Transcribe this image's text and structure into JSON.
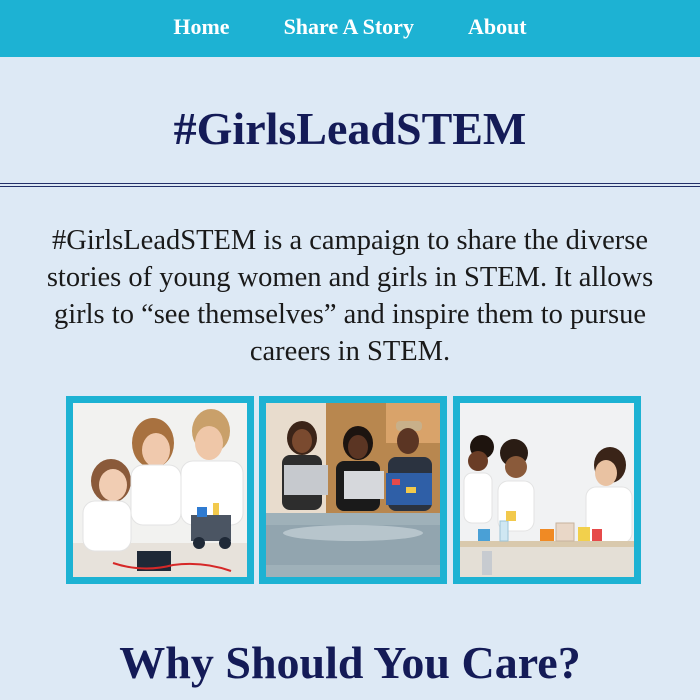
{
  "nav": {
    "items": [
      {
        "label": "Home"
      },
      {
        "label": "Share A Story"
      },
      {
        "label": "About"
      }
    ]
  },
  "header": {
    "title": "#GirlsLeadSTEM"
  },
  "intro": {
    "text": "#GirlsLeadSTEM is a campaign to share the diverse stories of young women and girls in STEM. It allows girls to “see themselves” and inspire them to pursue careers in STEM."
  },
  "gallery": {
    "images": [
      {
        "name": "robotics-photo"
      },
      {
        "name": "laptops-photo"
      },
      {
        "name": "chemistry-photo"
      }
    ]
  },
  "section": {
    "heading": "Why Should You Care?"
  },
  "colors": {
    "nav_background": "#1db2d3",
    "page_background": "#dde9f5",
    "heading_text": "#141b57",
    "photo_border": "#1db2d3"
  }
}
